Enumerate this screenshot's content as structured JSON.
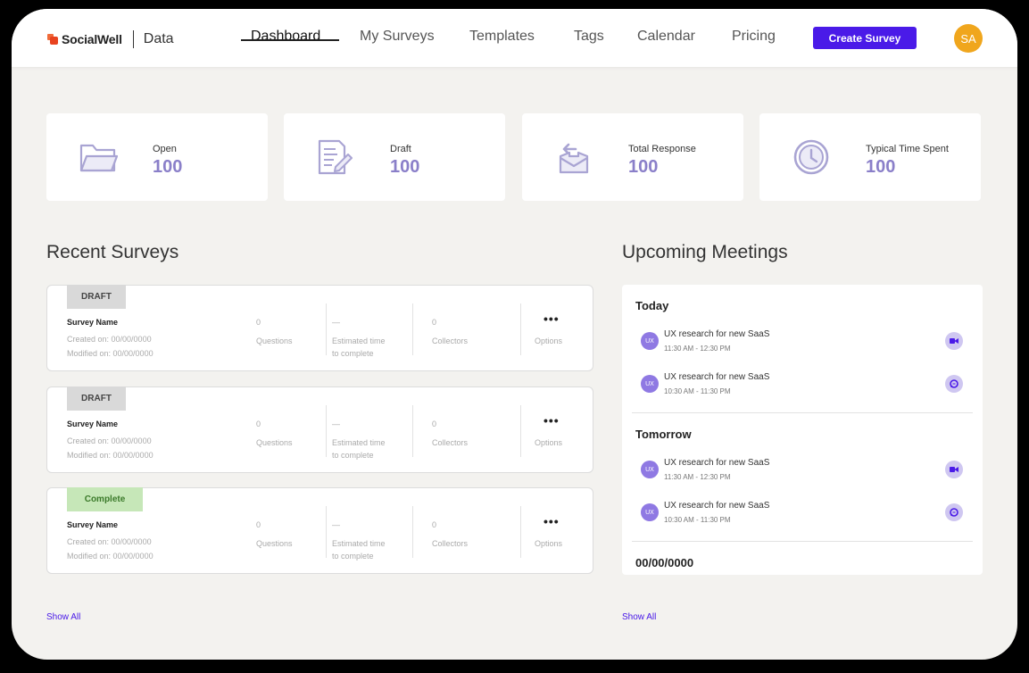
{
  "app": {
    "brand": "SocialWell",
    "section": "Data"
  },
  "nav": [
    {
      "label": "Dashboard",
      "active": true
    },
    {
      "label": "My Surveys"
    },
    {
      "label": "Templates"
    },
    {
      "label": "Tags"
    },
    {
      "label": "Calendar"
    },
    {
      "label": "Pricing"
    }
  ],
  "header": {
    "create_label": "Create Survey",
    "avatar_initials": "SA"
  },
  "stats": [
    {
      "label": "Open",
      "value": "100",
      "icon": "folder-icon"
    },
    {
      "label": "Draft",
      "value": "100",
      "icon": "document-edit-icon"
    },
    {
      "label": "Total Response",
      "value": "100",
      "icon": "inbox-arrow-icon"
    },
    {
      "label": "Typical Time Spent",
      "value": "100",
      "icon": "clock-icon"
    }
  ],
  "recent": {
    "title": "Recent Surveys",
    "show_all": "Show All",
    "surveys": [
      {
        "status": "DRAFT",
        "name": "Survey Name",
        "created": "Created on: 00/00/0000",
        "modified": "Modified on: 00/00/0000",
        "questions_value": "0",
        "questions_label": "Questions",
        "time_value": "—",
        "time_label_1": "Estimated time",
        "time_label_2": "to complete",
        "collectors_value": "0",
        "collectors_label": "Collectors",
        "options_label": "Options"
      },
      {
        "status": "DRAFT",
        "name": "Survey Name",
        "created": "Created on: 00/00/0000",
        "modified": "Modified on: 00/00/0000",
        "questions_value": "0",
        "questions_label": "Questions",
        "time_value": "—",
        "time_label_1": "Estimated time",
        "time_label_2": "to complete",
        "collectors_value": "0",
        "collectors_label": "Collectors",
        "options_label": "Options"
      },
      {
        "status": "Complete",
        "name": "Survey Name",
        "created": "Created on: 00/00/0000",
        "modified": "Modified on: 00/00/0000",
        "questions_value": "0",
        "questions_label": "Questions",
        "time_value": "—",
        "time_label_1": "Estimated time",
        "time_label_2": "to complete",
        "collectors_value": "0",
        "collectors_label": "Collectors",
        "options_label": "Options"
      }
    ]
  },
  "meetings": {
    "title": "Upcoming Meetings",
    "show_all": "Show All",
    "groups": [
      {
        "day": "Today",
        "items": [
          {
            "initials": "UX",
            "title": "UX research for new SaaS",
            "time": "11:30 AM - 12:30 PM",
            "action": "video-icon"
          },
          {
            "initials": "UX",
            "title": "UX research for new SaaS",
            "time": "10:30 AM - 11:30 PM",
            "action": "chat-icon"
          }
        ]
      },
      {
        "day": "Tomorrow",
        "items": [
          {
            "initials": "UX",
            "title": "UX research for new SaaS",
            "time": "11:30 AM - 12:30 PM",
            "action": "video-icon"
          },
          {
            "initials": "UX",
            "title": "UX research for new SaaS",
            "time": "10:30 AM - 11:30 PM",
            "action": "chat-icon"
          }
        ]
      },
      {
        "day": "00/00/0000",
        "items": []
      }
    ]
  },
  "colors": {
    "accent": "#4a1ae8",
    "stat_value": "#8a7fc9",
    "icon": "#a9a4d3",
    "avatar": "#f0a61d"
  }
}
